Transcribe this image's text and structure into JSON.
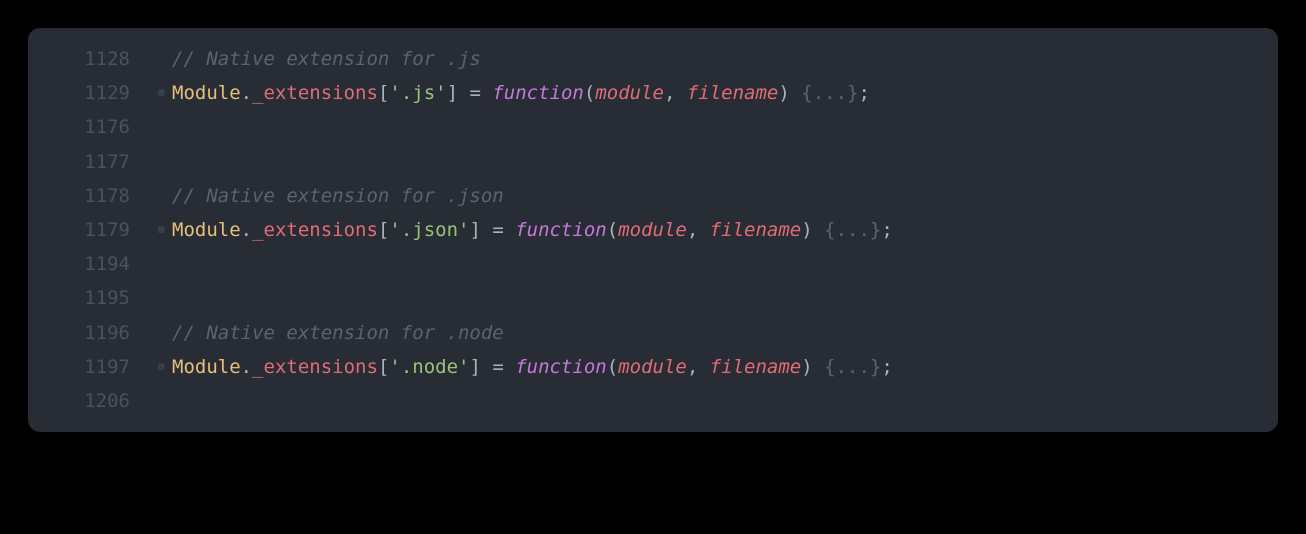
{
  "colors": {
    "background": "#282c34",
    "gutter": "#495162",
    "comment": "#5c6370",
    "className": "#e5c07b",
    "property": "#e06c75",
    "string": "#98c379",
    "keyword": "#c678dd",
    "default": "#abb2bf"
  },
  "lines": [
    {
      "number": "1128",
      "fold": "",
      "tokens": [
        {
          "cls": "comment",
          "text": "// Native extension for .js"
        }
      ]
    },
    {
      "number": "1129",
      "fold": "⊞",
      "tokens": [
        {
          "cls": "class-name",
          "text": "Module"
        },
        {
          "cls": "punct",
          "text": "."
        },
        {
          "cls": "property",
          "text": "_extensions"
        },
        {
          "cls": "punct",
          "text": "["
        },
        {
          "cls": "string",
          "text": "'.js'"
        },
        {
          "cls": "punct",
          "text": "] = "
        },
        {
          "cls": "keyword",
          "text": "function"
        },
        {
          "cls": "punct",
          "text": "("
        },
        {
          "cls": "param",
          "text": "module"
        },
        {
          "cls": "punct",
          "text": ", "
        },
        {
          "cls": "param",
          "text": "filename"
        },
        {
          "cls": "punct",
          "text": ") "
        },
        {
          "cls": "brace-dim",
          "text": "{"
        },
        {
          "cls": "folded",
          "text": "..."
        },
        {
          "cls": "brace-dim",
          "text": "}"
        },
        {
          "cls": "punct",
          "text": ";"
        }
      ]
    },
    {
      "number": "1176",
      "fold": "",
      "tokens": []
    },
    {
      "number": "1177",
      "fold": "",
      "tokens": []
    },
    {
      "number": "1178",
      "fold": "",
      "tokens": [
        {
          "cls": "comment",
          "text": "// Native extension for .json"
        }
      ]
    },
    {
      "number": "1179",
      "fold": "⊞",
      "tokens": [
        {
          "cls": "class-name",
          "text": "Module"
        },
        {
          "cls": "punct",
          "text": "."
        },
        {
          "cls": "property",
          "text": "_extensions"
        },
        {
          "cls": "punct",
          "text": "["
        },
        {
          "cls": "string",
          "text": "'.json'"
        },
        {
          "cls": "punct",
          "text": "] = "
        },
        {
          "cls": "keyword",
          "text": "function"
        },
        {
          "cls": "punct",
          "text": "("
        },
        {
          "cls": "param",
          "text": "module"
        },
        {
          "cls": "punct",
          "text": ", "
        },
        {
          "cls": "param",
          "text": "filename"
        },
        {
          "cls": "punct",
          "text": ") "
        },
        {
          "cls": "brace-dim",
          "text": "{"
        },
        {
          "cls": "folded",
          "text": "..."
        },
        {
          "cls": "brace-dim",
          "text": "}"
        },
        {
          "cls": "punct",
          "text": ";"
        }
      ]
    },
    {
      "number": "1194",
      "fold": "",
      "tokens": []
    },
    {
      "number": "1195",
      "fold": "",
      "tokens": []
    },
    {
      "number": "1196",
      "fold": "",
      "tokens": [
        {
          "cls": "comment",
          "text": "// Native extension for .node"
        }
      ]
    },
    {
      "number": "1197",
      "fold": "⊞",
      "tokens": [
        {
          "cls": "class-name",
          "text": "Module"
        },
        {
          "cls": "punct",
          "text": "."
        },
        {
          "cls": "property",
          "text": "_extensions"
        },
        {
          "cls": "punct",
          "text": "["
        },
        {
          "cls": "string",
          "text": "'.node'"
        },
        {
          "cls": "punct",
          "text": "] = "
        },
        {
          "cls": "keyword",
          "text": "function"
        },
        {
          "cls": "punct",
          "text": "("
        },
        {
          "cls": "param",
          "text": "module"
        },
        {
          "cls": "punct",
          "text": ", "
        },
        {
          "cls": "param",
          "text": "filename"
        },
        {
          "cls": "punct",
          "text": ") "
        },
        {
          "cls": "brace-dim",
          "text": "{"
        },
        {
          "cls": "folded",
          "text": "..."
        },
        {
          "cls": "brace-dim",
          "text": "}"
        },
        {
          "cls": "punct",
          "text": ";"
        }
      ]
    },
    {
      "number": "1206",
      "fold": "",
      "tokens": []
    }
  ]
}
